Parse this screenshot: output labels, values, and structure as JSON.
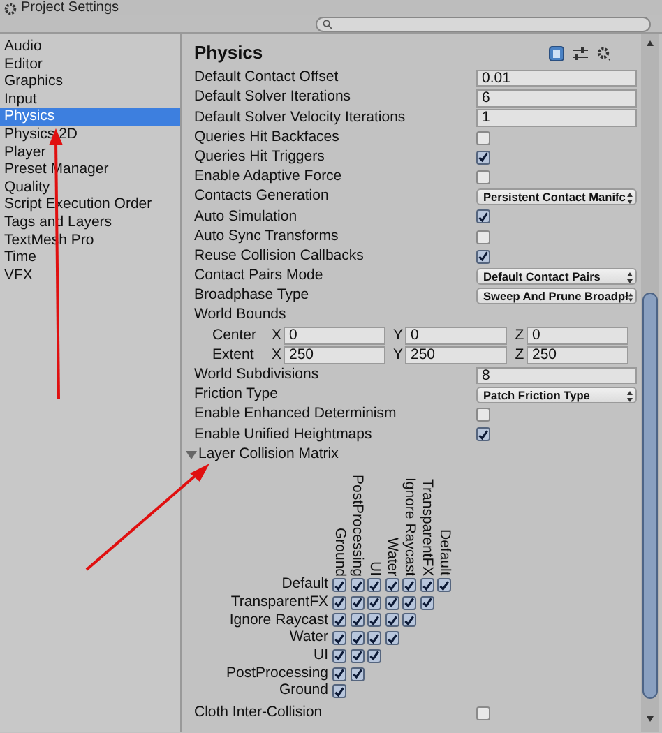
{
  "window": {
    "title": "Project Settings"
  },
  "sidebar": {
    "items": [
      {
        "label": "Audio",
        "selected": false
      },
      {
        "label": "Editor",
        "selected": false
      },
      {
        "label": "Graphics",
        "selected": false
      },
      {
        "label": "Input",
        "selected": false
      },
      {
        "label": "Physics",
        "selected": true
      },
      {
        "label": "Physics 2D",
        "selected": false
      },
      {
        "label": "Player",
        "selected": false
      },
      {
        "label": "Preset Manager",
        "selected": false
      },
      {
        "label": "Quality",
        "selected": false
      },
      {
        "label": "Script Execution Order",
        "selected": false
      },
      {
        "label": "Tags and Layers",
        "selected": false
      },
      {
        "label": "TextMesh Pro",
        "selected": false
      },
      {
        "label": "Time",
        "selected": false
      },
      {
        "label": "VFX",
        "selected": false
      }
    ]
  },
  "panel": {
    "title": "Physics",
    "settings": [
      {
        "kind": "field",
        "label": "Default Contact Offset",
        "value": "0.01"
      },
      {
        "kind": "field",
        "label": "Default Solver Iterations",
        "value": "6"
      },
      {
        "kind": "field",
        "label": "Default Solver Velocity Iterations",
        "value": "1"
      },
      {
        "kind": "checkbox",
        "label": "Queries Hit Backfaces",
        "checked": false
      },
      {
        "kind": "checkbox",
        "label": "Queries Hit Triggers",
        "checked": true
      },
      {
        "kind": "checkbox",
        "label": "Enable Adaptive Force",
        "checked": false
      },
      {
        "kind": "dropdown",
        "label": "Contacts Generation",
        "value": "Persistent Contact Manifc"
      },
      {
        "kind": "checkbox",
        "label": "Auto Simulation",
        "checked": true
      },
      {
        "kind": "checkbox",
        "label": "Auto Sync Transforms",
        "checked": false
      },
      {
        "kind": "checkbox",
        "label": "Reuse Collision Callbacks",
        "checked": true
      },
      {
        "kind": "dropdown",
        "label": "Contact Pairs Mode",
        "value": "Default Contact Pairs"
      },
      {
        "kind": "dropdown",
        "label": "Broadphase Type",
        "value": "Sweep And Prune Broadpł"
      },
      {
        "kind": "heading",
        "label": "World Bounds"
      },
      {
        "kind": "vector",
        "label": "Center",
        "components": [
          {
            "axis": "X",
            "value": "0"
          },
          {
            "axis": "Y",
            "value": "0"
          },
          {
            "axis": "Z",
            "value": "0"
          }
        ]
      },
      {
        "kind": "vector",
        "label": "Extent",
        "components": [
          {
            "axis": "X",
            "value": "250"
          },
          {
            "axis": "Y",
            "value": "250"
          },
          {
            "axis": "Z",
            "value": "250"
          }
        ]
      },
      {
        "kind": "field",
        "label": "World Subdivisions",
        "value": "8"
      },
      {
        "kind": "dropdown",
        "label": "Friction Type",
        "value": "Patch Friction Type"
      },
      {
        "kind": "checkbox",
        "label": "Enable Enhanced Determinism",
        "checked": false
      },
      {
        "kind": "checkbox",
        "label": "Enable Unified Heightmaps",
        "checked": true
      }
    ],
    "matrix": {
      "label": "Layer Collision Matrix",
      "expanded": true,
      "columns": [
        "Ground",
        "PostProcessing",
        "UI",
        "Water",
        "Ignore Raycast",
        "TransparentFX",
        "Default"
      ],
      "rows": [
        {
          "label": "Default",
          "checks": [
            true,
            true,
            true,
            true,
            true,
            true,
            true
          ]
        },
        {
          "label": "TransparentFX",
          "checks": [
            true,
            true,
            true,
            true,
            true,
            true
          ]
        },
        {
          "label": "Ignore Raycast",
          "checks": [
            true,
            true,
            true,
            true,
            true
          ]
        },
        {
          "label": "Water",
          "checks": [
            true,
            true,
            true,
            true
          ]
        },
        {
          "label": "UI",
          "checks": [
            true,
            true,
            true
          ]
        },
        {
          "label": "PostProcessing",
          "checks": [
            true,
            true
          ]
        },
        {
          "label": "Ground",
          "checks": [
            true
          ]
        }
      ]
    },
    "after": [
      {
        "kind": "checkbox",
        "label": "Cloth Inter-Collision",
        "checked": false
      }
    ]
  }
}
